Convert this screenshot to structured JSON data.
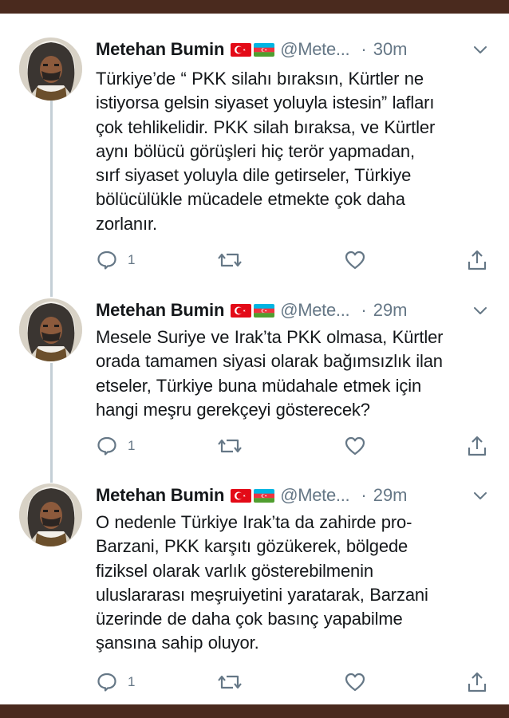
{
  "tweets": [
    {
      "name": "Metehan Bumin",
      "handle": "@Mete...",
      "dot": "·",
      "time": "30m",
      "lines": [
        "Türkiye’de “ PKK silahı bıraksın, Kürtler ne",
        "istiyorsa gelsin siyaset yoluyla istesin” lafları",
        "çok tehlikelidir. PKK silah bıraksa, ve Kürtler",
        "aynı bölücü görüşleri hiç terör yapmadan,",
        "sırf siyaset yoluyla dile getirseler, Türkiye",
        "bölücülükle mücadele etmekte çok daha",
        "zorlanır."
      ],
      "reply_count": "1"
    },
    {
      "name": "Metehan Bumin",
      "handle": "@Mete...",
      "dot": "·",
      "time": "29m",
      "lines": [
        "Mesele Suriye ve Irak’ta PKK olmasa, Kürtler",
        "orada tamamen siyasi olarak bağımsızlık ilan",
        "etseler, Türkiye buna müdahale etmek için",
        "hangi meşru gerekçeyi gösterecek?"
      ],
      "reply_count": "1"
    },
    {
      "name": "Metehan Bumin",
      "handle": "@Mete...",
      "dot": "·",
      "time": "29m",
      "lines": [
        "O nedenle Türkiye Irak’ta da zahirde pro-",
        "Barzani, PKK karşıtı gözükerek, bölgede",
        "fiziksel olarak varlık gösterebilmenin",
        "uluslararası meşruiyetini yaratarak, Barzani",
        "üzerinde de daha çok basınç yapabilme",
        "şansına sahip oluyor."
      ],
      "reply_count": "1"
    }
  ],
  "icons": {
    "reply": "reply-icon",
    "retweet": "retweet-icon",
    "like": "heart-icon",
    "share": "share-icon",
    "menu": "chevron-down-icon",
    "flag_tr": "turkey-flag-icon",
    "flag_az": "azerbaijan-flag-icon"
  },
  "colors": {
    "text": "#14171a",
    "secondary": "#657786",
    "frame": "#4a2a1e",
    "thread_line": "#c4cfd6"
  }
}
